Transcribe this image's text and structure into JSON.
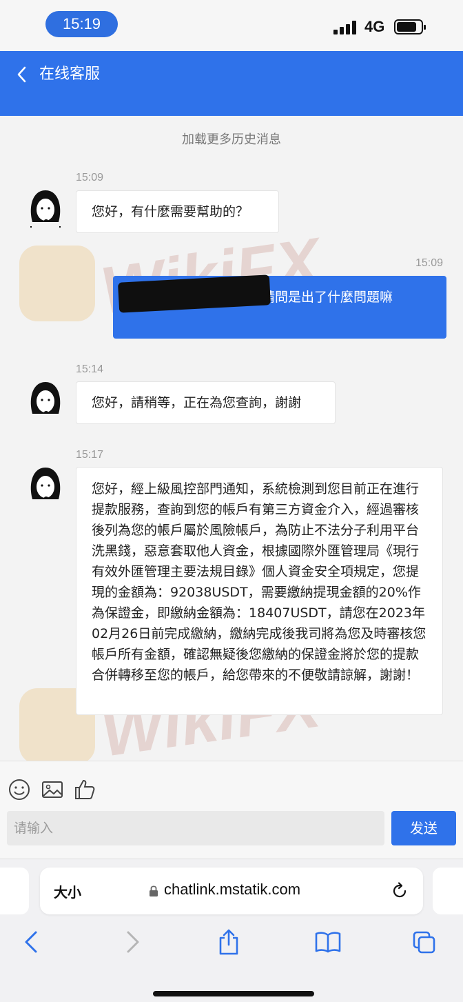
{
  "status_bar": {
    "time": "15:19",
    "network": "4G"
  },
  "header": {
    "title": "在线客服"
  },
  "chat": {
    "load_more": "加载更多历史消息",
    "messages": [
      {
        "time": "15:09",
        "text": "您好，有什麼需要幫助的？"
      },
      {
        "time": "15:09",
        "text": "我的提現為什麼會失敗 請問是出了什麼問題嘛"
      },
      {
        "time": "15:14",
        "text": "您好，請稍等，正在為您查詢，謝謝"
      },
      {
        "time": "15:17",
        "text": "您好，經上級風控部門通知，系統檢測到您目前正在進行提款服務，查詢到您的帳戶有第三方資金介入，經過審核後列為您的帳戶屬於風險帳戶，為防止不法分子利用平台洗黑錢，惡意套取他人資金，根據國際外匯管理局《現行有效外匯管理主要法規目錄》個人資金安全項規定，您提現的金額為：92038USDT，需要繳納提現金額的20%作為保證金，即繳納金額為：18407USDT，請您在2023年02月26日前完成繳納，繳納完成後我司將為您及時審核您帳戶所有金額，確認無疑後您繳納的保證金將於您的提款合併轉移至您的帳戶，給您帶來的不便敬請諒解，謝謝！"
      }
    ],
    "watermark": "WikiFX"
  },
  "composer": {
    "placeholder": "请输入",
    "send_label": "发送"
  },
  "browser": {
    "text_size_label": "大小",
    "url": "chatlink.mstatik.com"
  },
  "colors": {
    "accent": "#2f72ea",
    "watermark": "#b86c5c"
  }
}
